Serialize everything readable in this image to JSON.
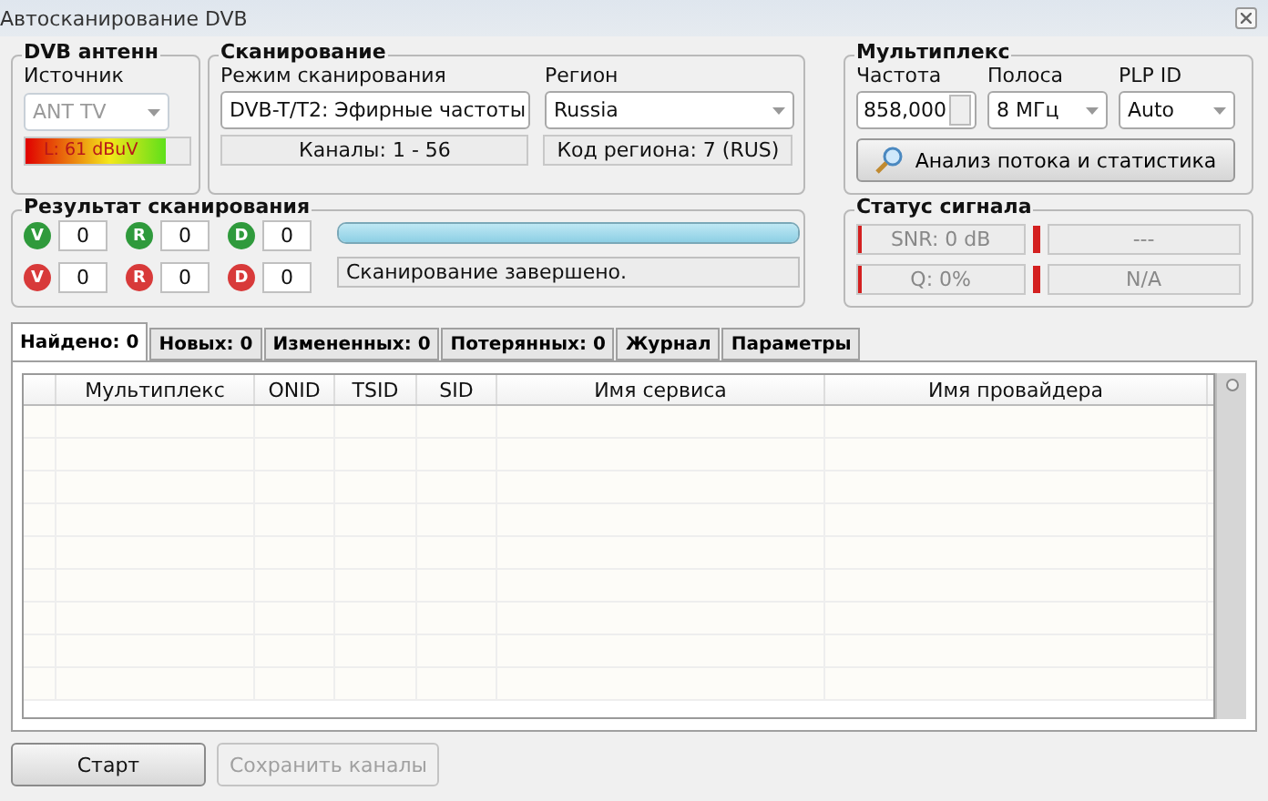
{
  "window": {
    "title": "Автосканирование DVB"
  },
  "antenna": {
    "title": "DVB антенн",
    "source_label": "Источник",
    "source": {
      "value": "ANT TV",
      "disabled": true
    },
    "meter": {
      "label": "L: 61 dBuV",
      "level": 0.85
    }
  },
  "scanning": {
    "title": "Сканирование",
    "mode_label": "Режим сканирования",
    "mode": "DVB-T/T2: Эфирные частоты",
    "region_label": "Регион",
    "region": "Russia",
    "channels": "Каналы: 1 - 56",
    "region_code": "Код региона: 7 (RUS)"
  },
  "multiplex": {
    "title": "Мультиплекс",
    "freq_label": "Частота",
    "freq": "858,000",
    "band_label": "Полоса",
    "band": "8 МГц",
    "plp_label": "PLP ID",
    "plp": "Auto",
    "analyze_button": "Анализ потока и статистика"
  },
  "results": {
    "title": "Результат сканирования",
    "counters": [
      {
        "letter": "V",
        "color": "#2f9a3c",
        "value": "0"
      },
      {
        "letter": "R",
        "color": "#2f9a3c",
        "value": "0"
      },
      {
        "letter": "D",
        "color": "#2f9a3c",
        "value": "0"
      },
      {
        "letter": "V",
        "color": "#d83a3a",
        "value": "0"
      },
      {
        "letter": "R",
        "color": "#d83a3a",
        "value": "0"
      },
      {
        "letter": "D",
        "color": "#d83a3a",
        "value": "0"
      }
    ],
    "progress": {
      "level": 1
    },
    "status": "Сканирование завершено."
  },
  "signal": {
    "title": "Статус сигнала",
    "rows": [
      {
        "reading": "SNR: 0 dB",
        "level": 0,
        "value": "---"
      },
      {
        "reading": "Q: 0%",
        "level": 0,
        "value": "N/A"
      }
    ]
  },
  "tabs": [
    {
      "label": "Найдено: 0",
      "selected": true
    },
    {
      "label": "Новых: 0",
      "selected": false
    },
    {
      "label": "Измененных: 0",
      "selected": false
    },
    {
      "label": "Потерянных: 0",
      "selected": false
    },
    {
      "label": "Журнал",
      "selected": false
    },
    {
      "label": "Параметры",
      "selected": false
    }
  ],
  "table": {
    "columns": [
      "Мультиплекс",
      "ONID",
      "TSID",
      "SID",
      "Имя сервиса",
      "Имя провайдера"
    ]
  },
  "buttons": [
    {
      "label": "Старт",
      "disabled": false
    },
    {
      "label": "Сохранить каналы",
      "disabled": true
    }
  ]
}
